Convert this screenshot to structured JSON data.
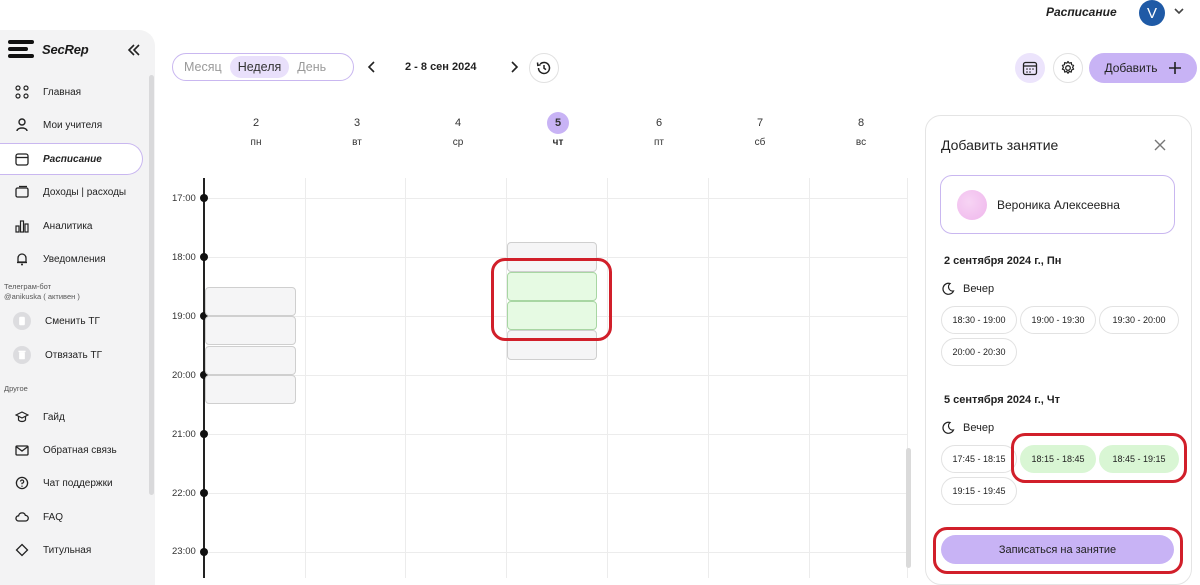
{
  "header": {
    "title": "Расписание",
    "avatar_letter": "V"
  },
  "sidebar": {
    "brand": "SecRep",
    "items": [
      {
        "label": "Главная",
        "icon": "grid-dots-icon"
      },
      {
        "label": "Мои учителя",
        "icon": "person-icon"
      },
      {
        "label": "Расписание",
        "icon": "calendar-icon",
        "active": true
      },
      {
        "label": "Доходы | расходы",
        "icon": "wallet-icon"
      },
      {
        "label": "Аналитика",
        "icon": "chart-icon"
      },
      {
        "label": "Уведомления",
        "icon": "bell-icon"
      }
    ],
    "telegram_label": "Телеграм-бот",
    "telegram_status": "@anikuska ( активен )",
    "telegram_items": [
      {
        "label": "Сменить ТГ",
        "icon": "swap-icon"
      },
      {
        "label": "Отвязать ТГ",
        "icon": "trash-icon"
      }
    ],
    "other_label": "Другое",
    "other_items": [
      {
        "label": "Гайд",
        "icon": "graduation-cap-icon"
      },
      {
        "label": "Обратная связь",
        "icon": "mail-icon"
      },
      {
        "label": "Чат поддержки",
        "icon": "chat-question-icon"
      },
      {
        "label": "FAQ",
        "icon": "cloud-icon"
      },
      {
        "label": "Титульная",
        "icon": "diamond-icon"
      }
    ]
  },
  "toolbar": {
    "views": [
      "Месяц",
      "Неделя",
      "День"
    ],
    "selected_view": "Неделя",
    "date_range": "2 - 8 сен 2024",
    "add_label": "Добавить"
  },
  "calendar": {
    "days": [
      {
        "num": "2",
        "name": "пн"
      },
      {
        "num": "3",
        "name": "вт"
      },
      {
        "num": "4",
        "name": "ср"
      },
      {
        "num": "5",
        "name": "чт",
        "today": true
      },
      {
        "num": "6",
        "name": "пт"
      },
      {
        "num": "7",
        "name": "сб"
      },
      {
        "num": "8",
        "name": "вс"
      }
    ],
    "hours": [
      "17:00",
      "18:00",
      "19:00",
      "20:00",
      "21:00",
      "22:00",
      "23:00"
    ]
  },
  "panel": {
    "title": "Добавить занятие",
    "student": "Вероника Алексеевна",
    "groups": [
      {
        "date": "2 сентября 2024 г., Пн",
        "period": "Вечер",
        "slots": [
          {
            "label": "18:30 - 19:00",
            "selected": false
          },
          {
            "label": "19:00 - 19:30",
            "selected": false
          },
          {
            "label": "19:30 - 20:00",
            "selected": false
          },
          {
            "label": "20:00 - 20:30",
            "selected": false
          }
        ]
      },
      {
        "date": "5 сентября 2024 г., Чт",
        "period": "Вечер",
        "slots": [
          {
            "label": "17:45 - 18:15",
            "selected": false
          },
          {
            "label": "18:15 - 18:45",
            "selected": true
          },
          {
            "label": "18:45 - 19:15",
            "selected": true
          },
          {
            "label": "19:15 - 19:45",
            "selected": false
          }
        ]
      }
    ],
    "submit_label": "Записаться на занятие"
  },
  "colors": {
    "accent": "#c8b3f5",
    "selected_slot": "#d9f6d4",
    "highlight_ring": "#d11f2a"
  }
}
